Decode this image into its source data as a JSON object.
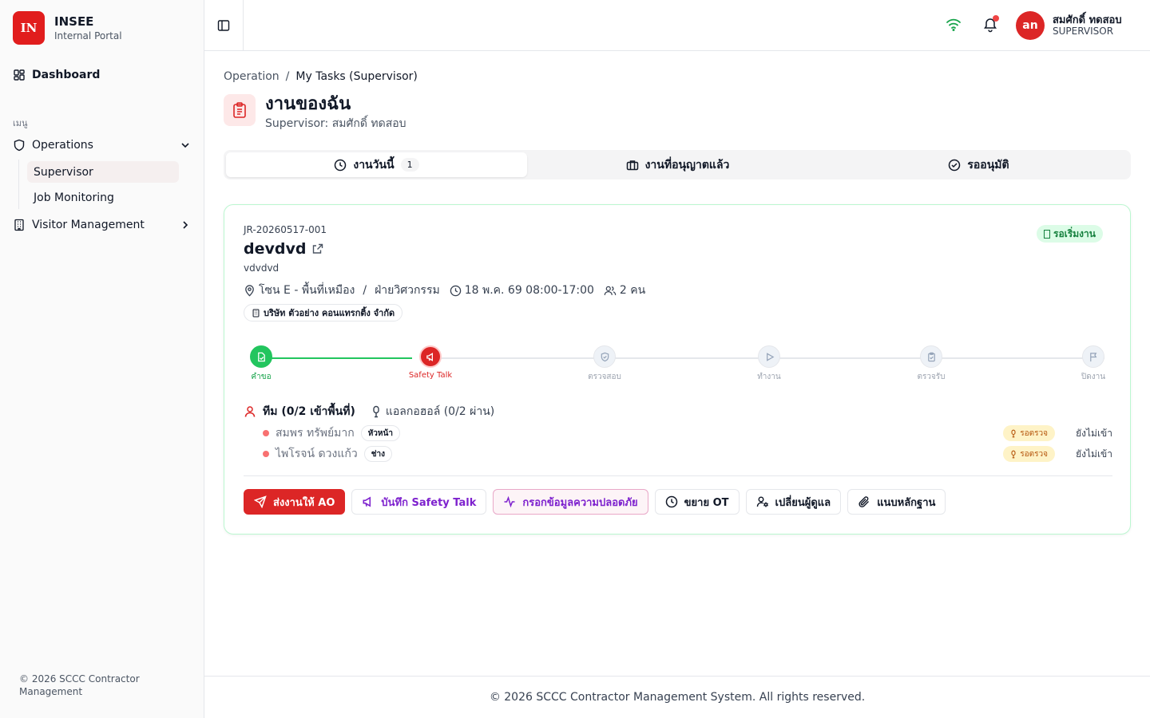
{
  "brand": {
    "logo": "IN",
    "name": "INSEE",
    "subtitle": "Internal Portal"
  },
  "sidebar": {
    "dashboard": "Dashboard",
    "section_label": "เมนู",
    "operations": "Operations",
    "operations_children": [
      "Supervisor",
      "Job Monitoring"
    ],
    "visitor": "Visitor Management",
    "footer": "© 2026 SCCC Contractor Management"
  },
  "header": {
    "avatar_initials": "an",
    "user_name": "สมศักดิ์ ทดสอบ",
    "user_role": "SUPERVISOR",
    "notification_dot_color": "#ef4444"
  },
  "breadcrumb": {
    "parent": "Operation",
    "separator": "/",
    "current": "My Tasks (Supervisor)"
  },
  "page": {
    "title": "งานของฉัน",
    "subtitle": "Supervisor: สมศักดิ์ ทดสอบ"
  },
  "tabs": [
    {
      "label": "งานวันนี้",
      "count": "1",
      "active": true
    },
    {
      "label": "งานที่อนุญาตแล้ว"
    },
    {
      "label": "รออนุมัติ"
    }
  ],
  "job": {
    "id": "JR-20260517-001",
    "status": "รอเริ่มงาน",
    "title": "devdvd",
    "description": "vdvdvd",
    "location": "โซน E - พื้นที่เหมือง",
    "meta_separator": "/",
    "department": "ฝ่ายวิศวกรรม",
    "schedule": "18 พ.ค. 69 08:00-17:00",
    "people": "2 คน",
    "company": "บริษัท ตัวอย่าง คอนแทรกติ้ง จำกัด",
    "steps": [
      {
        "label": "คำขอ",
        "state": "done"
      },
      {
        "label": "Safety Talk",
        "state": "current"
      },
      {
        "label": "ตรวจสอบ",
        "state": "pending"
      },
      {
        "label": "ทำงาน",
        "state": "pending"
      },
      {
        "label": "ตรวจรับ",
        "state": "pending"
      },
      {
        "label": "ปิดงาน",
        "state": "pending"
      }
    ],
    "team_label": "ทีม (0/2 เข้าพื้นที่)",
    "alcohol_label": "แอลกอฮอล์ (0/2 ผ่าน)",
    "members": [
      {
        "name": "สมพร ทรัพย์มาก",
        "role": "หัวหน้า",
        "check": "รอตรวจ",
        "entry": "ยังไม่เข้า"
      },
      {
        "name": "ไพโรจน์ ดวงแก้ว",
        "role": "ช่าง",
        "check": "รอตรวจ",
        "entry": "ยังไม่เข้า"
      }
    ]
  },
  "actions": {
    "send_ao": "ส่งงานให้ AO",
    "safety_talk": "บันทึก Safety Talk",
    "safety_info": "กรอกข้อมูลความปลอดภัย",
    "extend_ot": "ขยาย OT",
    "change_supervisor": "เปลี่ยนผู้ดูแล",
    "attach_evidence": "แนบหลักฐาน"
  },
  "colors": {
    "accent": "#dc2626",
    "success": "#22c55e",
    "purple": "#7e22ce"
  },
  "footer": "© 2026 SCCC Contractor Management System. All rights reserved."
}
